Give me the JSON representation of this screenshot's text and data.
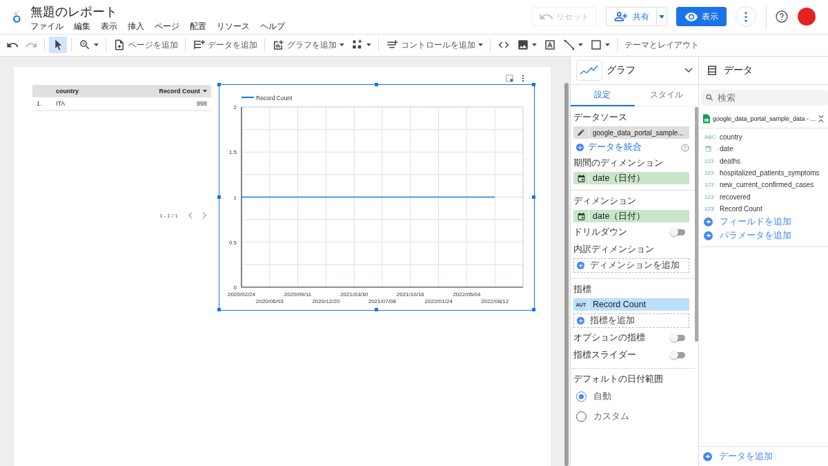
{
  "header": {
    "title": "無題のレポート",
    "menu": [
      "ファイル",
      "編集",
      "表示",
      "挿入",
      "ページ",
      "配置",
      "リソース",
      "ヘルプ"
    ],
    "reset": {
      "label": "リセット",
      "disabled": true
    },
    "share": {
      "label": "共有"
    },
    "view": {
      "label": "表示"
    }
  },
  "toolbar": {
    "items": [
      {
        "kind": "icon",
        "dropdown": false,
        "disabled": false,
        "selected": false
      },
      {
        "kind": "icon",
        "dropdown": false,
        "disabled": true,
        "selected": false
      },
      {
        "kind": "icon",
        "dropdown": false,
        "disabled": false,
        "selected": true
      },
      {
        "kind": "icon",
        "dropdown": true,
        "disabled": false,
        "selected": false
      },
      {
        "kind": "text",
        "label": "ページを追加",
        "dropdown": false,
        "disabled": false,
        "selected": false
      },
      {
        "kind": "text",
        "label": "データを追加",
        "dropdown": false,
        "disabled": false,
        "selected": false
      },
      {
        "kind": "text",
        "label": "グラフを追加",
        "dropdown": true,
        "disabled": false,
        "selected": false
      },
      {
        "kind": "icon",
        "dropdown": true,
        "disabled": false,
        "selected": false
      },
      {
        "kind": "text",
        "label": "コントロールを追加",
        "dropdown": true,
        "disabled": false,
        "selected": false
      },
      {
        "kind": "icon",
        "dropdown": false,
        "disabled": false,
        "selected": false
      },
      {
        "kind": "icon",
        "dropdown": true,
        "disabled": false,
        "selected": false
      },
      {
        "kind": "icon",
        "dropdown": false,
        "disabled": false,
        "selected": false
      },
      {
        "kind": "icon",
        "dropdown": true,
        "disabled": false,
        "selected": false
      },
      {
        "kind": "icon",
        "dropdown": true,
        "disabled": false,
        "selected": false
      },
      {
        "kind": "text",
        "label": "テーマとレイアウト",
        "dropdown": false,
        "disabled": false,
        "selected": false
      }
    ]
  },
  "table": {
    "columns": [
      "country",
      "Record Count"
    ],
    "rows": [
      {
        "index": "1.",
        "country": "ITA",
        "record_count": "998"
      }
    ],
    "pagination": "1 - 1 / 1"
  },
  "chart": {
    "chart_data": {
      "type": "line",
      "categories": [
        "2020/02/24",
        "2020/06/03",
        "2020/09/11",
        "2020/12/20",
        "2021/03/30",
        "2021/07/08",
        "2021/10/16",
        "2022/01/24",
        "2022/05/04",
        "2022/08/12"
      ],
      "series": [
        {
          "name": "Record Count",
          "color": "#1a73e8",
          "values": [
            1,
            1,
            1,
            1,
            1,
            1,
            1,
            1,
            1,
            1
          ]
        }
      ],
      "ylim": [
        0,
        2
      ],
      "yticks": [
        0,
        0.5,
        1,
        1.5,
        2
      ],
      "grid": true
    }
  },
  "properties": {
    "chart_type": "グラフ",
    "tabs": [
      {
        "label": "設定",
        "selected": true
      },
      {
        "label": "スタイル",
        "selected": false
      }
    ],
    "data_source": {
      "heading": "データソース",
      "value": "google_data_portal_sample...",
      "blend": "データを統合"
    },
    "date_range_dimension": {
      "heading": "期間のディメンション",
      "chip": "date（日付）"
    },
    "dimension": {
      "heading": "ディメンション",
      "chip": "date（日付）"
    },
    "drilldown": {
      "label": "ドリルダウン",
      "on": false
    },
    "breakdown": {
      "heading": "内訳ディメンション",
      "add": "ディメンションを追加"
    },
    "metric": {
      "heading": "指標",
      "badge": "AUT",
      "chip": "Record Count",
      "add": "指標を追加"
    },
    "toggles": [
      {
        "label": "オプションの指標",
        "on": false
      },
      {
        "label": "指標スライダー",
        "on": false
      }
    ],
    "date_range": {
      "heading": "デフォルトの日付範囲",
      "options": [
        {
          "label": "自動",
          "selected": true
        },
        {
          "label": "カスタム",
          "selected": false
        }
      ]
    }
  },
  "data_panel": {
    "title": "データ",
    "search": {
      "placeholder": "検索"
    },
    "source": "google_data_portal_sample_data - ...",
    "fields": [
      {
        "kind": "text",
        "badge": "ABC",
        "name": "country"
      },
      {
        "kind": "date",
        "name": "date"
      },
      {
        "kind": "number",
        "badge": "123",
        "name": "deaths"
      },
      {
        "kind": "number",
        "badge": "123",
        "name": "hospitalized_patients_symptoms"
      },
      {
        "kind": "number",
        "badge": "123",
        "name": "new_current_confirmed_cases"
      },
      {
        "kind": "number",
        "badge": "123",
        "name": "recovered"
      },
      {
        "kind": "metric",
        "badge": "123",
        "name": "Record Count"
      }
    ],
    "add_field": "フィールドを追加",
    "add_parameter": "パラメータを追加",
    "add_data": "データを追加"
  }
}
